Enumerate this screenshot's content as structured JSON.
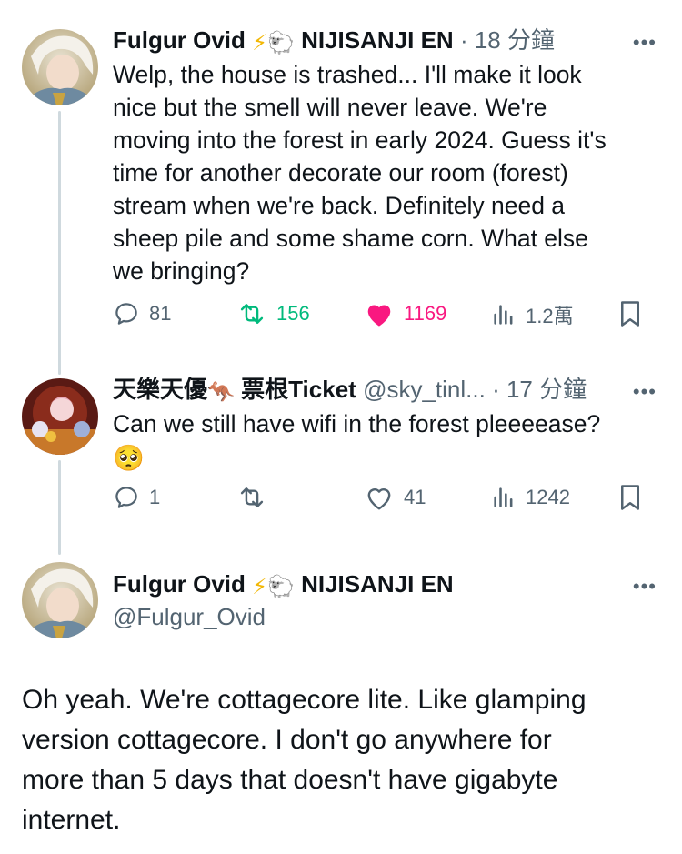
{
  "tweets": [
    {
      "name": "Fulgur Ovid",
      "emojis": "⚡🐑",
      "affiliation": "NIJISANJI EN",
      "meta": "· 18 分鐘",
      "text": "Welp, the house is trashed... I'll make it look\nnice but the smell will never leave. We're\nmoving into the forest in early 2024. Guess it's\ntime for another decorate our room (forest)\nstream when we're back. Definitely need a\nsheep pile and some shame corn. What else\nwe bringing?",
      "replies": "81",
      "reposts": "156",
      "likes": "1169",
      "views": "1.2萬",
      "more": "•••"
    },
    {
      "name": "天樂天優",
      "emoji_kangaroo": "🦘",
      "ticket": "票根Ticket",
      "handle": "@sky_tinl...",
      "meta": "· 17 分鐘",
      "text": "Can we still have wifi in the forest pleeeease?",
      "emoji_plead": "🥺",
      "replies": "1",
      "reposts": "",
      "likes": "41",
      "views": "1242",
      "more": "•••"
    },
    {
      "name": "Fulgur Ovid",
      "emojis": "⚡🐑",
      "affiliation": "NIJISANJI EN",
      "handle": "@Fulgur_Ovid",
      "text": "Oh yeah. We're cottagecore lite. Like glamping\nversion cottagecore. I don't go anywhere for\nmore than 5 days that doesn't have gigabyte\ninternet.",
      "more": "•••"
    }
  ],
  "colors": {
    "text": "#0f1419",
    "muted": "#536471",
    "repost": "#00ba7c",
    "like": "#f91880",
    "thread_line": "#cfd9de"
  },
  "icons": [
    "reply-icon",
    "repost-icon",
    "heart-icon",
    "views-icon",
    "bookmark-icon"
  ]
}
